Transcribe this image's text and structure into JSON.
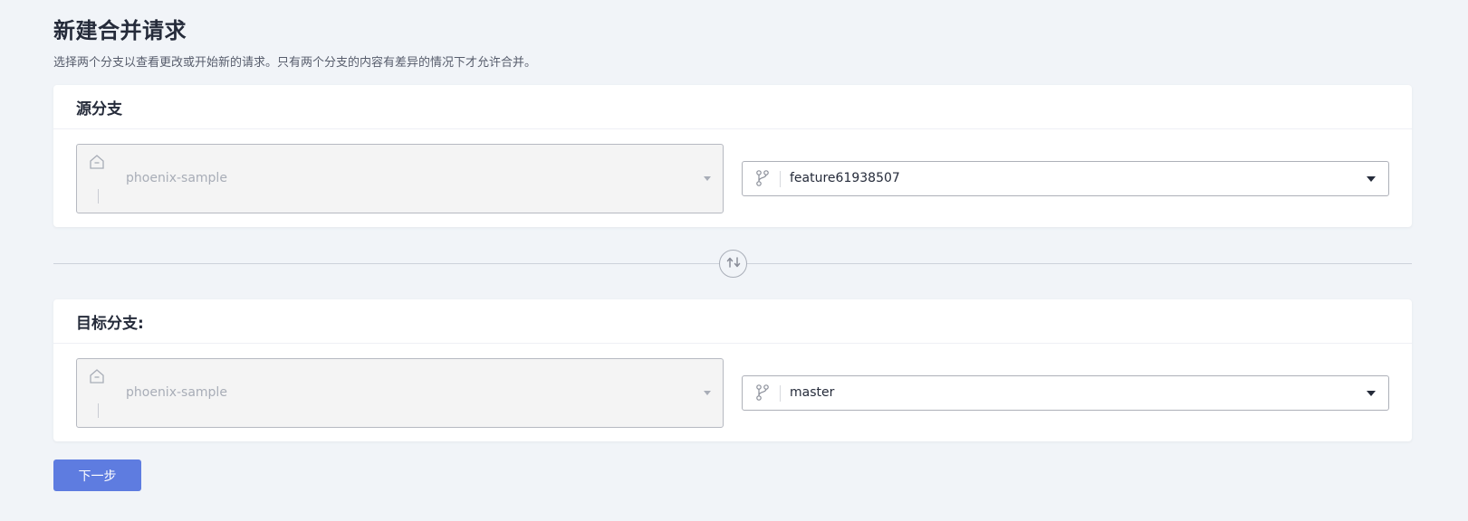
{
  "page": {
    "title": "新建合并请求",
    "description": "选择两个分支以查看更改或开始新的请求。只有两个分支的内容有差异的情况下才允许合并。"
  },
  "source": {
    "header": "源分支",
    "repo": {
      "value": "phoenix-sample",
      "icon": "repo-icon"
    },
    "branch": {
      "value": "feature61938507",
      "icon": "branch-icon"
    }
  },
  "target": {
    "header": "目标分支:",
    "repo": {
      "value": "phoenix-sample",
      "icon": "repo-icon"
    },
    "branch": {
      "value": "master",
      "icon": "branch-icon"
    }
  },
  "swap": {
    "icon": "swap-icon"
  },
  "actions": {
    "next_label": "下一步"
  },
  "colors": {
    "background": "#f1f4f8",
    "primary": "#5e7ce0",
    "text": "#252b3a",
    "muted_text": "#575d6c",
    "disabled_text": "#a8adb7"
  }
}
